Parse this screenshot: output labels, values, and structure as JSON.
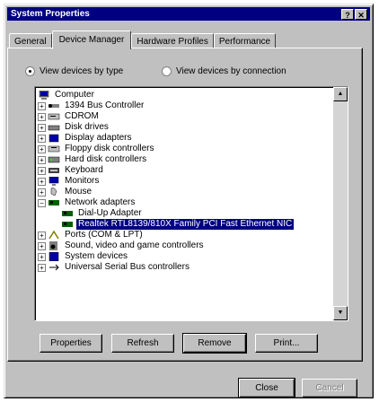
{
  "window": {
    "title": "System Properties",
    "help_glyph": "?",
    "close_glyph": "✕"
  },
  "tabs": [
    {
      "label": "General",
      "active": false
    },
    {
      "label": "Device Manager",
      "active": true
    },
    {
      "label": "Hardware Profiles",
      "active": false
    },
    {
      "label": "Performance",
      "active": false
    }
  ],
  "view_options": {
    "by_type": "View devices by type",
    "by_connection": "View devices by connection",
    "selected": "by_type"
  },
  "tree": [
    {
      "label": "Computer",
      "icon": "computer-icon",
      "expander": "",
      "level": 0
    },
    {
      "label": "1394 Bus Controller",
      "icon": "bus-controller-icon",
      "expander": "+",
      "level": 1
    },
    {
      "label": "CDROM",
      "icon": "cdrom-icon",
      "expander": "+",
      "level": 1
    },
    {
      "label": "Disk drives",
      "icon": "disk-drive-icon",
      "expander": "+",
      "level": 1
    },
    {
      "label": "Display adapters",
      "icon": "display-adapter-icon",
      "expander": "+",
      "level": 1
    },
    {
      "label": "Floppy disk controllers",
      "icon": "floppy-controller-icon",
      "expander": "+",
      "level": 1
    },
    {
      "label": "Hard disk controllers",
      "icon": "hard-disk-controller-icon",
      "expander": "+",
      "level": 1
    },
    {
      "label": "Keyboard",
      "icon": "keyboard-icon",
      "expander": "+",
      "level": 1
    },
    {
      "label": "Monitors",
      "icon": "monitor-icon",
      "expander": "+",
      "level": 1
    },
    {
      "label": "Mouse",
      "icon": "mouse-icon",
      "expander": "+",
      "level": 1
    },
    {
      "label": "Network adapters",
      "icon": "network-adapter-icon",
      "expander": "−",
      "level": 1
    },
    {
      "label": "Dial-Up Adapter",
      "icon": "network-card-icon",
      "expander": "",
      "level": 2
    },
    {
      "label": "Realtek RTL8139/810X Family PCI Fast Ethernet NIC",
      "icon": "network-card-icon",
      "expander": "",
      "level": 2,
      "selected": true
    },
    {
      "label": "Ports (COM & LPT)",
      "icon": "port-icon",
      "expander": "+",
      "level": 1
    },
    {
      "label": "Sound, video and game controllers",
      "icon": "sound-icon",
      "expander": "+",
      "level": 1
    },
    {
      "label": "System devices",
      "icon": "system-device-icon",
      "expander": "+",
      "level": 1
    },
    {
      "label": "Universal Serial Bus controllers",
      "icon": "usb-icon",
      "expander": "+",
      "level": 1
    }
  ],
  "actions": {
    "properties": "Properties",
    "refresh": "Refresh",
    "remove": "Remove",
    "print": "Print..."
  },
  "footer": {
    "close": "Close",
    "cancel": "Cancel"
  },
  "colors": {
    "title_bar": "#000080",
    "selection": "#000080",
    "face": "#c0c0c0"
  }
}
